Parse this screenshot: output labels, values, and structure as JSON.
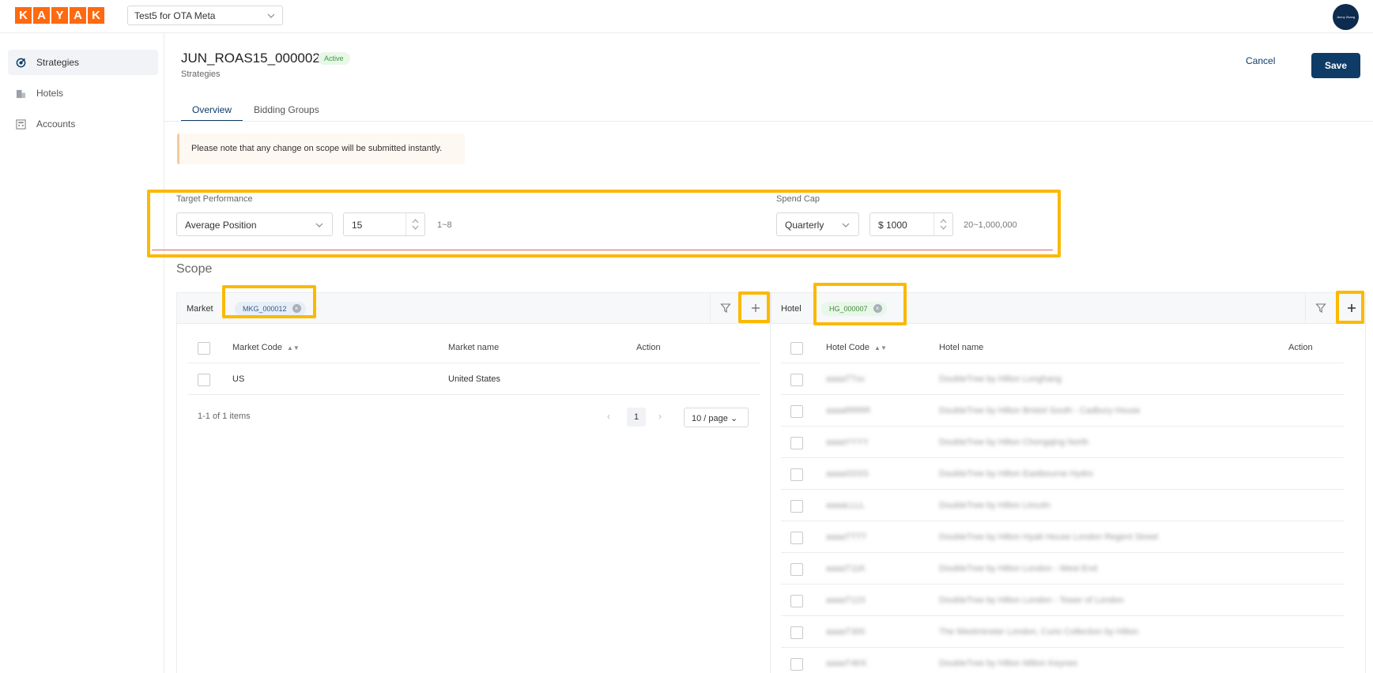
{
  "brand": {
    "letters": [
      "K",
      "A",
      "Y",
      "A",
      "K"
    ],
    "color": "#ff690f"
  },
  "account_selector": {
    "value": "Test5 for OTA Meta"
  },
  "user": {
    "avatar_text": "Jenny Zhang"
  },
  "sidebar": {
    "items": [
      {
        "label": "Strategies",
        "icon": "target-icon",
        "active": true
      },
      {
        "label": "Hotels",
        "icon": "building-icon",
        "active": false
      },
      {
        "label": "Accounts",
        "icon": "calculator-icon",
        "active": false
      }
    ]
  },
  "header": {
    "title": "JUN_ROAS15_000002",
    "status": "Active",
    "breadcrumb": "Strategies",
    "cancel_label": "Cancel",
    "save_label": "Save"
  },
  "tabs": [
    {
      "label": "Overview",
      "active": true
    },
    {
      "label": "Bidding Groups",
      "active": false
    }
  ],
  "notice": "Please note that any change on scope will be submitted instantly.",
  "target_performance": {
    "label": "Target Performance",
    "metric": "Average Position",
    "value": "15",
    "range_hint": "1~8"
  },
  "spend_cap": {
    "label": "Spend Cap",
    "period": "Quarterly",
    "value": "$ 1000",
    "range_hint": "20~1,000,000"
  },
  "scope": {
    "title": "Scope",
    "market": {
      "label": "Market",
      "tag": "MKG_000012",
      "columns": [
        "Market Code",
        "Market name",
        "Action"
      ],
      "rows": [
        {
          "code": "US",
          "name": "United States"
        }
      ],
      "pagination": {
        "total": "1-1 of 1 items",
        "page": "1",
        "page_size": "10 / page"
      }
    },
    "hotel": {
      "label": "Hotel",
      "tag": "HG_000007",
      "columns": [
        "Hotel Code",
        "Hotel name",
        "Action"
      ],
      "rows": [
        {
          "code": "aaaaTTxx",
          "name": "DoubleTree by Hilton Longhang"
        },
        {
          "code": "aaaaRRRR",
          "name": "DoubleTree by Hilton Bristol South - Cadbury House"
        },
        {
          "code": "aaaaYYYY",
          "name": "DoubleTree by Hilton Chongqing North"
        },
        {
          "code": "aaaaSSSS",
          "name": "DoubleTree by Hilton Eastbourne Hydro"
        },
        {
          "code": "aaaaLLLL",
          "name": "DoubleTree by Hilton Lincoln"
        },
        {
          "code": "aaaaTTTT",
          "name": "DoubleTree by Hilton Hyatt House London Regent Street"
        },
        {
          "code": "aaaaT11K",
          "name": "DoubleTree by Hilton London - West End"
        },
        {
          "code": "aaaaT123",
          "name": "DoubleTree by Hilton London - Tower of London"
        },
        {
          "code": "aaaaT300",
          "name": "The Westminster London, Curio Collection by Hilton"
        },
        {
          "code": "aaaaT4KK",
          "name": "DoubleTree by Hilton Milton Keynes"
        }
      ]
    }
  },
  "colors": {
    "primary": "#0f3c66",
    "highlight": "#fbb900",
    "active_badge": "#3a9a3a"
  }
}
